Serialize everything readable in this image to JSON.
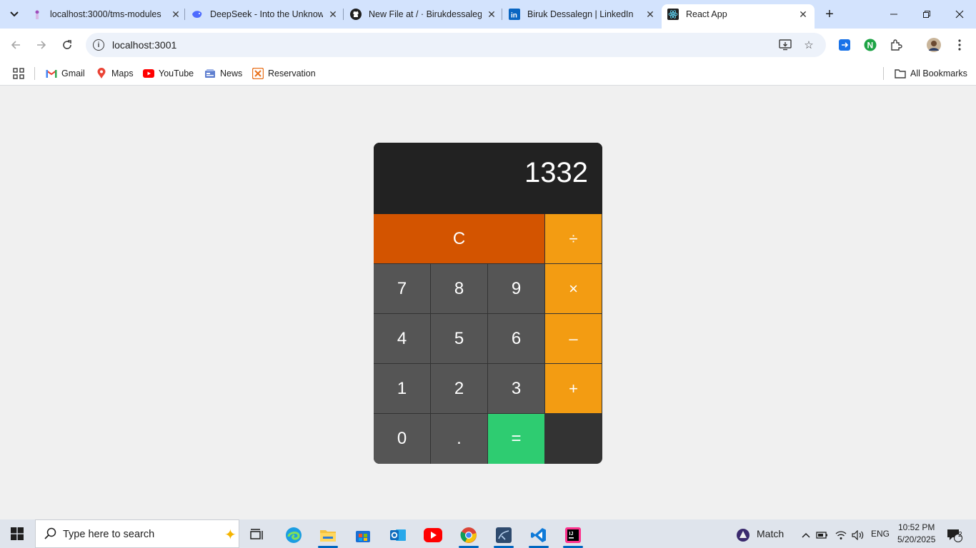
{
  "tabs": [
    {
      "title": "localhost:3000/tms-modules",
      "active": false
    },
    {
      "title": "DeepSeek - Into the Unknown",
      "active": false
    },
    {
      "title": "New File at / · Birukdessalegn",
      "active": false
    },
    {
      "title": "Biruk Dessalegn | LinkedIn",
      "active": false
    },
    {
      "title": "React App",
      "active": true
    }
  ],
  "omnibox": {
    "url": "localhost:3001"
  },
  "bookmarks": {
    "items": [
      "Gmail",
      "Maps",
      "YouTube",
      "News",
      "Reservation"
    ],
    "all_label": "All Bookmarks"
  },
  "calculator": {
    "display": "1332",
    "keys": {
      "clear": "C",
      "divide": "÷",
      "multiply": "×",
      "subtract": "–",
      "add": "+",
      "equals": "=",
      "seven": "7",
      "eight": "8",
      "nine": "9",
      "four": "4",
      "five": "5",
      "six": "6",
      "one": "1",
      "two": "2",
      "three": "3",
      "zero": "0",
      "decimal": "."
    },
    "colors": {
      "display_bg": "#222222",
      "number": "#555555",
      "operator": "#f39c12",
      "clear": "#d35400",
      "equals": "#2ecc71"
    }
  },
  "taskbar": {
    "search_placeholder": "Type here to search",
    "weather": "Match",
    "language": "ENG",
    "time": "10:52 PM",
    "date": "5/20/2025",
    "notifications": "2"
  }
}
